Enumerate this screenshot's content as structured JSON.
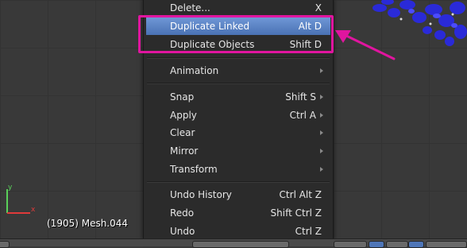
{
  "viewport": {
    "object_label": "(1905) Mesh.044",
    "axis": {
      "x_label": "x",
      "y_label": "y"
    }
  },
  "menu": {
    "items": [
      {
        "label": "Delete...",
        "shortcut": "X",
        "submenu": false
      },
      {
        "label": "Duplicate Linked",
        "shortcut": "Alt D",
        "submenu": false,
        "highlighted": true
      },
      {
        "label": "Duplicate Objects",
        "shortcut": "Shift D",
        "submenu": false
      },
      {
        "label": "Animation",
        "shortcut": "",
        "submenu": true
      },
      {
        "label": "Snap",
        "shortcut": "Shift S",
        "submenu": true
      },
      {
        "label": "Apply",
        "shortcut": "Ctrl A",
        "submenu": true
      },
      {
        "label": "Clear",
        "shortcut": "",
        "submenu": true
      },
      {
        "label": "Mirror",
        "shortcut": "",
        "submenu": true
      },
      {
        "label": "Transform",
        "shortcut": "",
        "submenu": true
      },
      {
        "label": "Undo History",
        "shortcut": "Ctrl Alt Z",
        "submenu": false
      },
      {
        "label": "Redo",
        "shortcut": "Shift Ctrl Z",
        "submenu": false
      },
      {
        "label": "Undo",
        "shortcut": "Ctrl Z",
        "submenu": false
      }
    ]
  },
  "colors": {
    "highlight_box": "#e0159f",
    "menu_active": "#5a82c4",
    "viewport_bg": "#393939",
    "menu_bg": "#2b2b2b",
    "foliage": "#2a2ad8"
  }
}
